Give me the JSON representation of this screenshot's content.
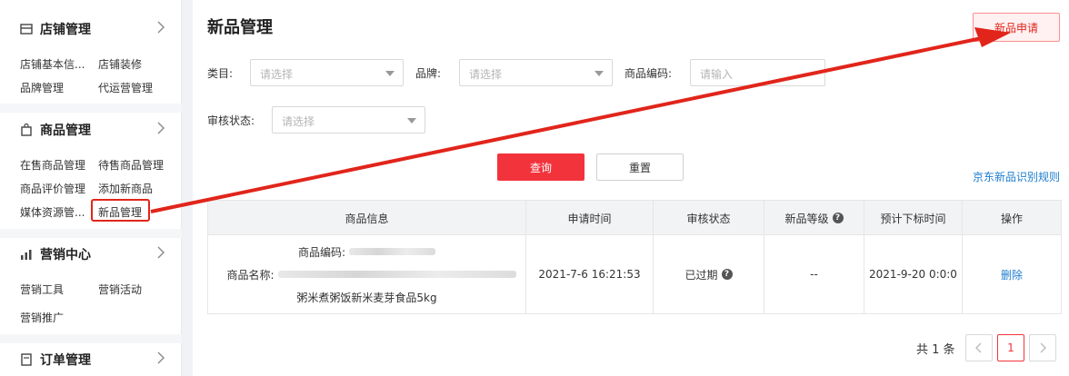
{
  "sidebar": {
    "sections": [
      {
        "title": "店铺管理",
        "icon": "store-icon",
        "items": [
          "店铺基本信...",
          "店铺装修",
          "品牌管理",
          "代运营管理"
        ]
      },
      {
        "title": "商品管理",
        "icon": "bag-icon",
        "items": [
          "在售商品管理",
          "待售商品管理",
          "商品评价管理",
          "添加新商品",
          "媒体资源管...",
          "新品管理"
        ]
      },
      {
        "title": "营销中心",
        "icon": "chart-icon",
        "items": [
          "营销工具",
          "营销活动",
          "营销推广"
        ]
      },
      {
        "title": "订单管理",
        "icon": "order-icon",
        "items": []
      }
    ]
  },
  "main": {
    "title": "新品管理",
    "apply_button": "新品申请",
    "filters": {
      "category_label": "类目:",
      "category_placeholder": "请选择",
      "brand_label": "品牌:",
      "brand_placeholder": "请选择",
      "code_label": "商品编码:",
      "code_placeholder": "请输入",
      "status_label": "审核状态:",
      "status_placeholder": "请选择"
    },
    "query_button": "查询",
    "reset_button": "重置",
    "rule_link": "京东新品识别规则",
    "table": {
      "headers": [
        "商品信息",
        "申请时间",
        "审核状态",
        "新品等级",
        "预计下标时间",
        "操作"
      ],
      "rows": [
        {
          "code_label": "商品编码:",
          "name_label": "商品名称:",
          "name_tail": "粥米煮粥饭新米麦芽食品5kg",
          "apply_time": "2021-7-6 16:21:53",
          "status": "已过期",
          "level": "--",
          "expected_time": "2021-9-20 0:0:0",
          "action": "删除"
        }
      ]
    },
    "pagination": {
      "total": "共 1 条",
      "prev": "<",
      "current": "1",
      "next": ">"
    }
  },
  "colors": {
    "accent": "#f2333c",
    "link": "#1d7dcf",
    "annotation": "#e1251b"
  }
}
